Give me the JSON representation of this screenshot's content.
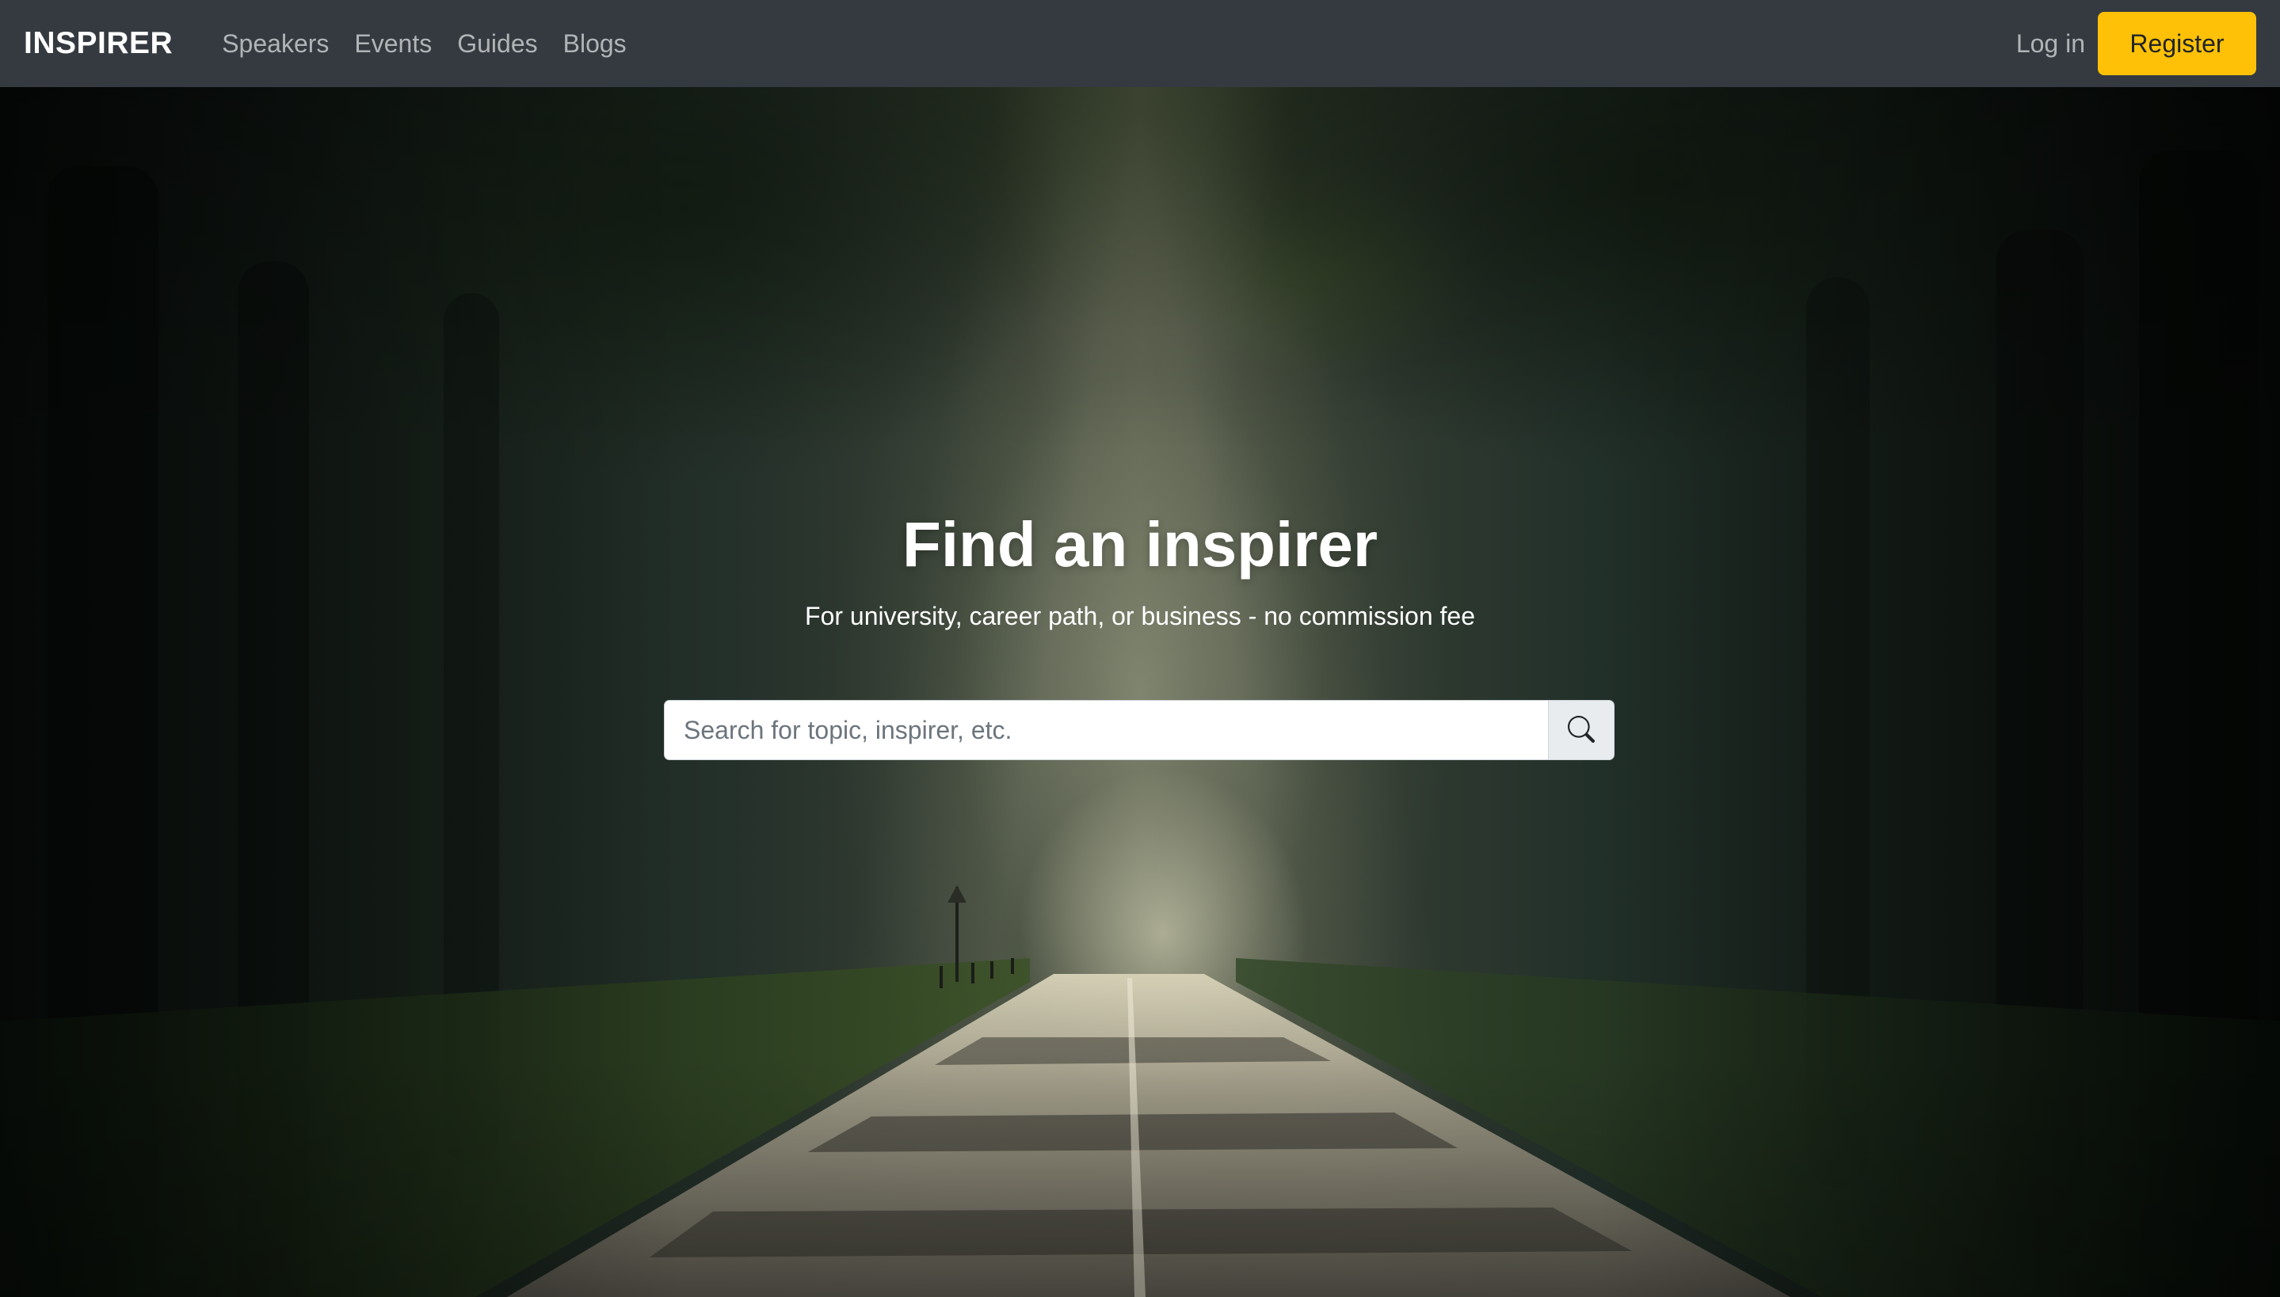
{
  "navbar": {
    "brand": "INSPIRER",
    "links": [
      {
        "label": "Speakers"
      },
      {
        "label": "Events"
      },
      {
        "label": "Guides"
      },
      {
        "label": "Blogs"
      }
    ],
    "login_label": "Log in",
    "register_label": "Register",
    "bg_color": "#343a40",
    "register_color": "#ffc107"
  },
  "hero": {
    "title": "Find an inspirer",
    "subtitle": "For university, career path, or business - no commission fee",
    "background": "forest-road-image",
    "search": {
      "placeholder": "Search for topic, inspirer, etc.",
      "value": "",
      "button_icon": "search-icon"
    }
  }
}
